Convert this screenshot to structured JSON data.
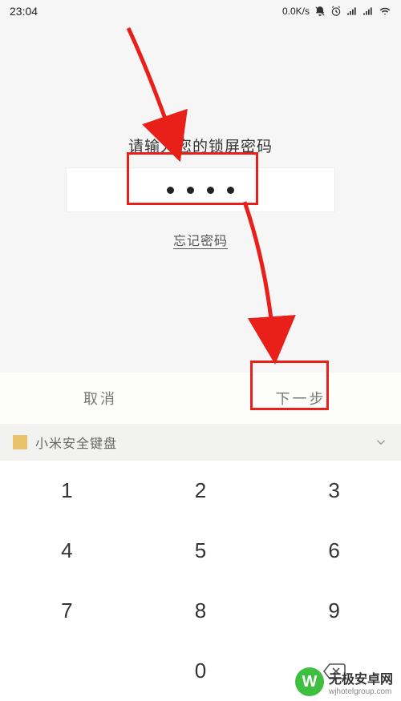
{
  "statusbar": {
    "time": "23:04",
    "speed": "0.0K/s"
  },
  "prompt": "请输入您的锁屏密码",
  "password_dots": 4,
  "forgot_label": "忘记密码",
  "actions": {
    "cancel": "取消",
    "next": "下一步"
  },
  "keyboard_header": "小米安全键盘",
  "keypad": [
    "1",
    "2",
    "3",
    "4",
    "5",
    "6",
    "7",
    "8",
    "9",
    "",
    "0",
    ""
  ],
  "watermark": {
    "logo_text": "W",
    "title": "无极安卓网",
    "url": "wjhotelgroup.com"
  },
  "colors": {
    "highlight": "#e9201a",
    "accent_arrow": "#e9201a",
    "wm_green": "#3fbf3f"
  }
}
